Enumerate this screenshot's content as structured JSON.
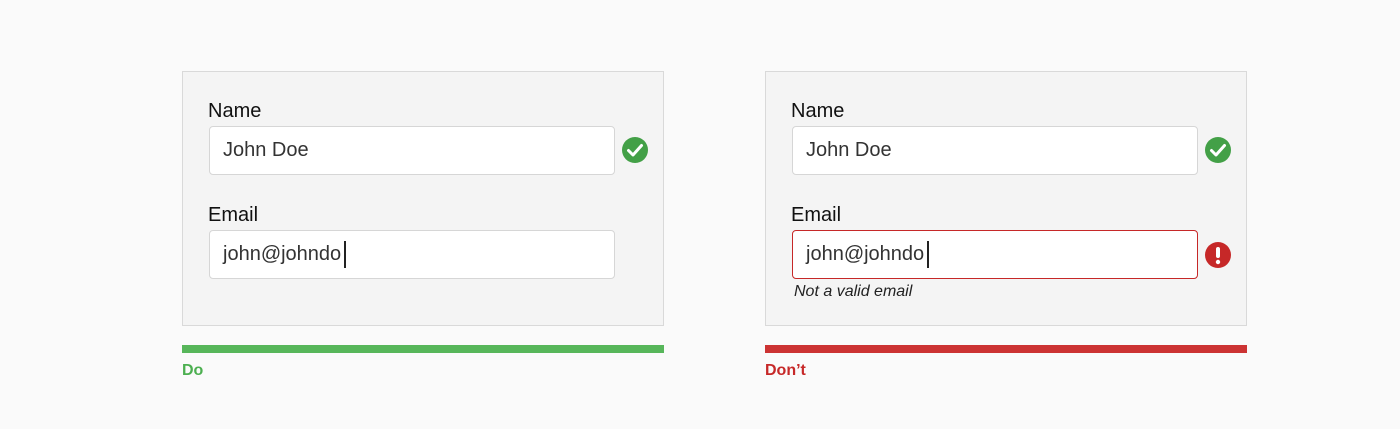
{
  "colors": {
    "background": "#fafafa",
    "success": "#43a047",
    "error": "#c62828",
    "do_bar": "#57b65a",
    "dont_bar": "#cc3333"
  },
  "do_example": {
    "name_label": "Name",
    "name_value": "John Doe",
    "name_status_icon": "check-circle-icon",
    "email_label": "Email",
    "email_value": "john@johndo",
    "verdict": "Do"
  },
  "dont_example": {
    "name_label": "Name",
    "name_value": "John Doe",
    "name_status_icon": "check-circle-icon",
    "email_label": "Email",
    "email_value": "john@johndo",
    "email_status_icon": "exclamation-circle-icon",
    "email_error": "Not a valid email",
    "verdict": "Don’t"
  }
}
